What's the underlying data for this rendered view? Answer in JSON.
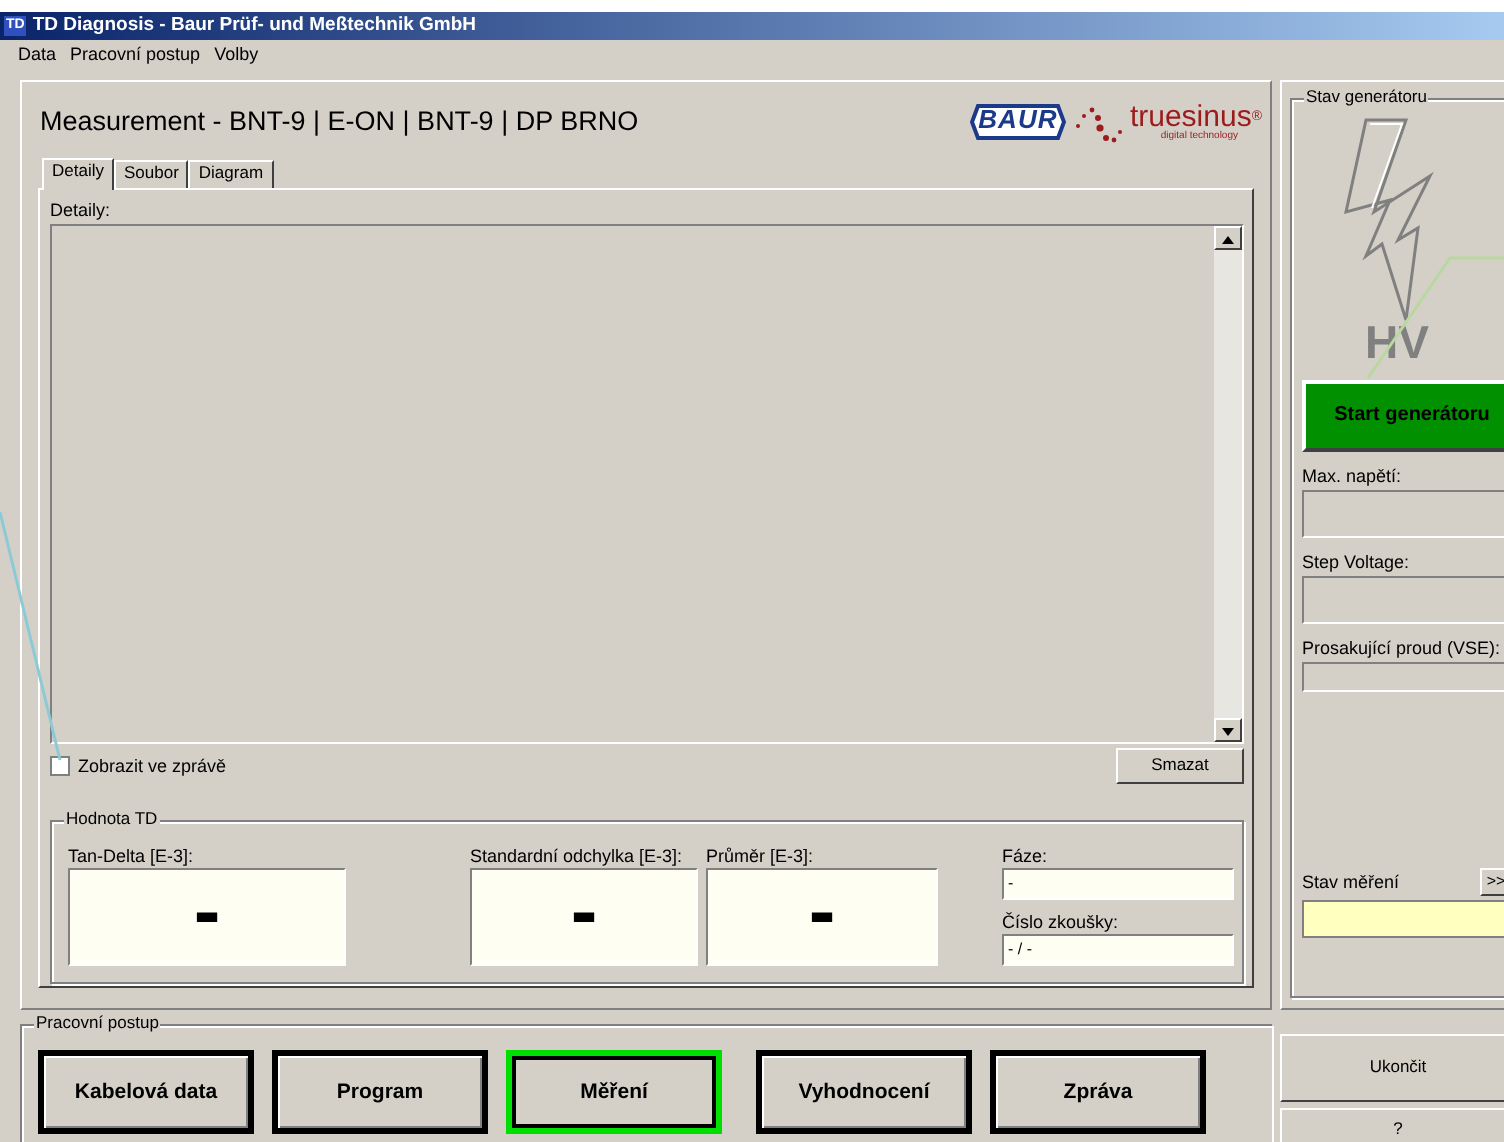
{
  "window": {
    "title": "TD Diagnosis - Baur Prüf- und Meßtechnik GmbH",
    "app_icon": "TD"
  },
  "menu": [
    "Data",
    "Pracovní postup",
    "Volby"
  ],
  "header": {
    "title": "Measurement - BNT-9 | E-ON | BNT-9 | DP BRNO",
    "logo_baur": "BAUR",
    "logo_truesinus": "truesinus",
    "logo_mark": "®",
    "logo_tagline": "digital technology"
  },
  "tabs": [
    {
      "label": "Detaily",
      "selected": true
    },
    {
      "label": "Soubor",
      "selected": false
    },
    {
      "label": "Diagram",
      "selected": false
    }
  ],
  "details": {
    "label": "Detaily:"
  },
  "show_in_report": {
    "label": "Zobrazit ve zprávě",
    "checked": false
  },
  "clear_button": "Smazat",
  "td_values": {
    "title": "Hodnota TD",
    "fields": [
      {
        "label": "Tan-Delta [E-3]:",
        "value": "-"
      },
      {
        "label": "Standardní odchylka [E-3]:",
        "value": "-"
      },
      {
        "label": "Průměr [E-3]:",
        "value": "-"
      }
    ]
  },
  "phase": {
    "label": "Fáze:",
    "value": "-"
  },
  "test_number": {
    "label": "Číslo zkoušky:",
    "value": "- / -"
  },
  "generator": {
    "title": "Stav generátoru",
    "hv_label": "HV",
    "start_button": "Start generátoru",
    "fields": [
      {
        "label": "Max. napětí:"
      },
      {
        "label": "Step Voltage:"
      },
      {
        "label": "Prosakující proud (VSE):"
      }
    ],
    "status_label": "Stav měření",
    "expand_button": ">>"
  },
  "workflow": {
    "title": "Pracovní postup",
    "steps": [
      {
        "label": "Kabelová data",
        "selected": false
      },
      {
        "label": "Program",
        "selected": false
      },
      {
        "label": "Měření",
        "selected": true
      },
      {
        "label": "Vyhodnocení",
        "selected": false
      },
      {
        "label": "Zpráva",
        "selected": false
      }
    ]
  },
  "exit_button": "Ukončit",
  "help_button": "?"
}
